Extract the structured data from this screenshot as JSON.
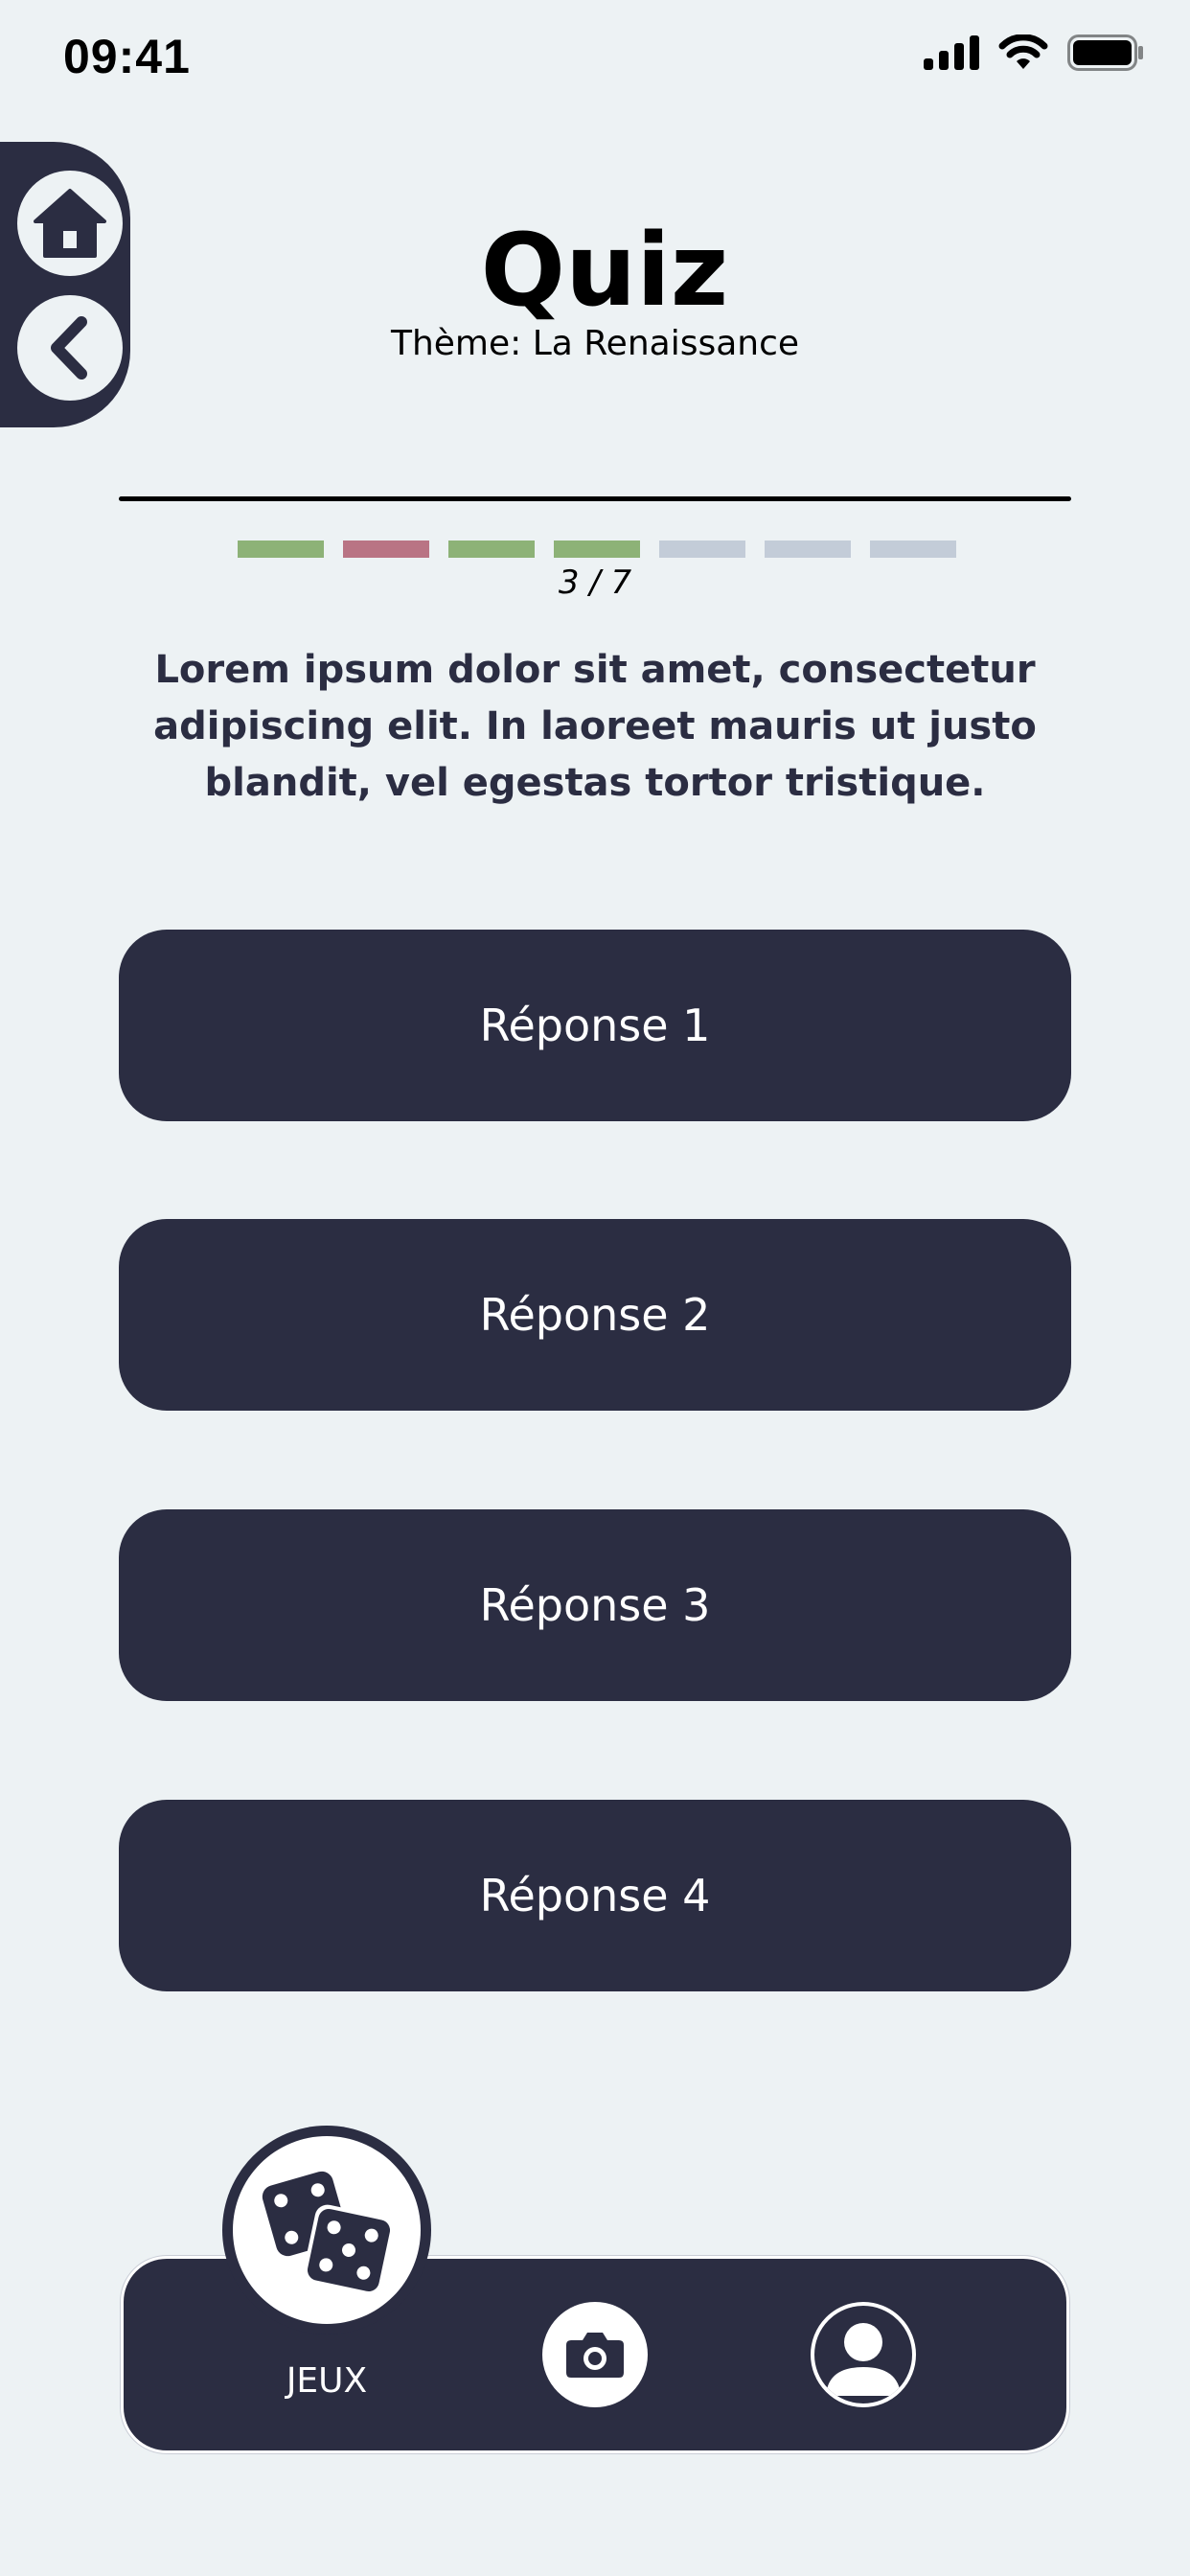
{
  "status_bar": {
    "time": "09:41"
  },
  "header": {
    "title": "Quiz",
    "subtitle": "Thème: La Renaissance"
  },
  "progress": {
    "counter": "3 / 7",
    "current": 3,
    "total": 7,
    "segments": [
      "correct",
      "wrong",
      "correct",
      "correct",
      "pending",
      "pending",
      "pending"
    ]
  },
  "colors": {
    "background": "#edf2f4",
    "primary": "#2b2d42",
    "correct": "#8db277",
    "wrong": "#b97484",
    "pending": "#c3ccd8"
  },
  "question": {
    "text": "Lorem ipsum dolor sit amet, consectetur adipiscing elit. In laoreet mauris ut justo blandit, vel egestas tortor tristique."
  },
  "answers": [
    {
      "label": "Réponse 1"
    },
    {
      "label": "Réponse 2"
    },
    {
      "label": "Réponse 3"
    },
    {
      "label": "Réponse 4"
    }
  ],
  "side_nav": {
    "icons": [
      "home-icon",
      "chevron-left-icon"
    ]
  },
  "bottom_nav": {
    "games_label": "JEUX",
    "icons": [
      "dice-icon",
      "camera-icon",
      "user-icon"
    ]
  }
}
